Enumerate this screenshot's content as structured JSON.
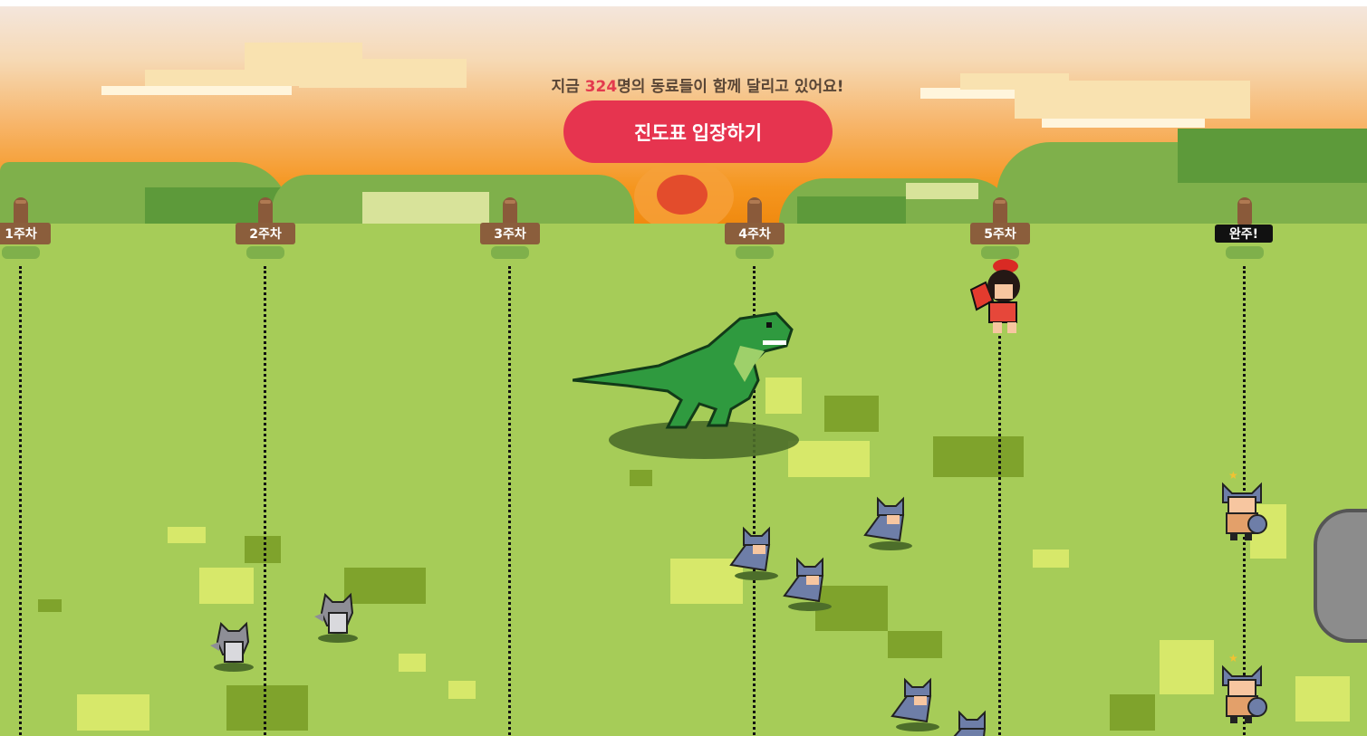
{
  "header": {
    "prefix": "지금 ",
    "count": "324",
    "suffix": "명의 동료들이 함께 달리고 있어요!"
  },
  "cta": {
    "label": "진도표 입장하기"
  },
  "milestones": [
    {
      "label": "1주차"
    },
    {
      "label": "2주차"
    },
    {
      "label": "3주차"
    },
    {
      "label": "4주차"
    },
    {
      "label": "5주차"
    },
    {
      "label": "완주!"
    }
  ],
  "colors": {
    "accent": "#e6344f",
    "count_highlight": "#e33a4e",
    "field": "#a6cc58",
    "sky_sunset": "#f5961f"
  },
  "icons": [
    "dinosaur-sprite",
    "wolf-cub-sprite",
    "caveman-sprite",
    "warrior-sprite",
    "stone-boulder"
  ]
}
